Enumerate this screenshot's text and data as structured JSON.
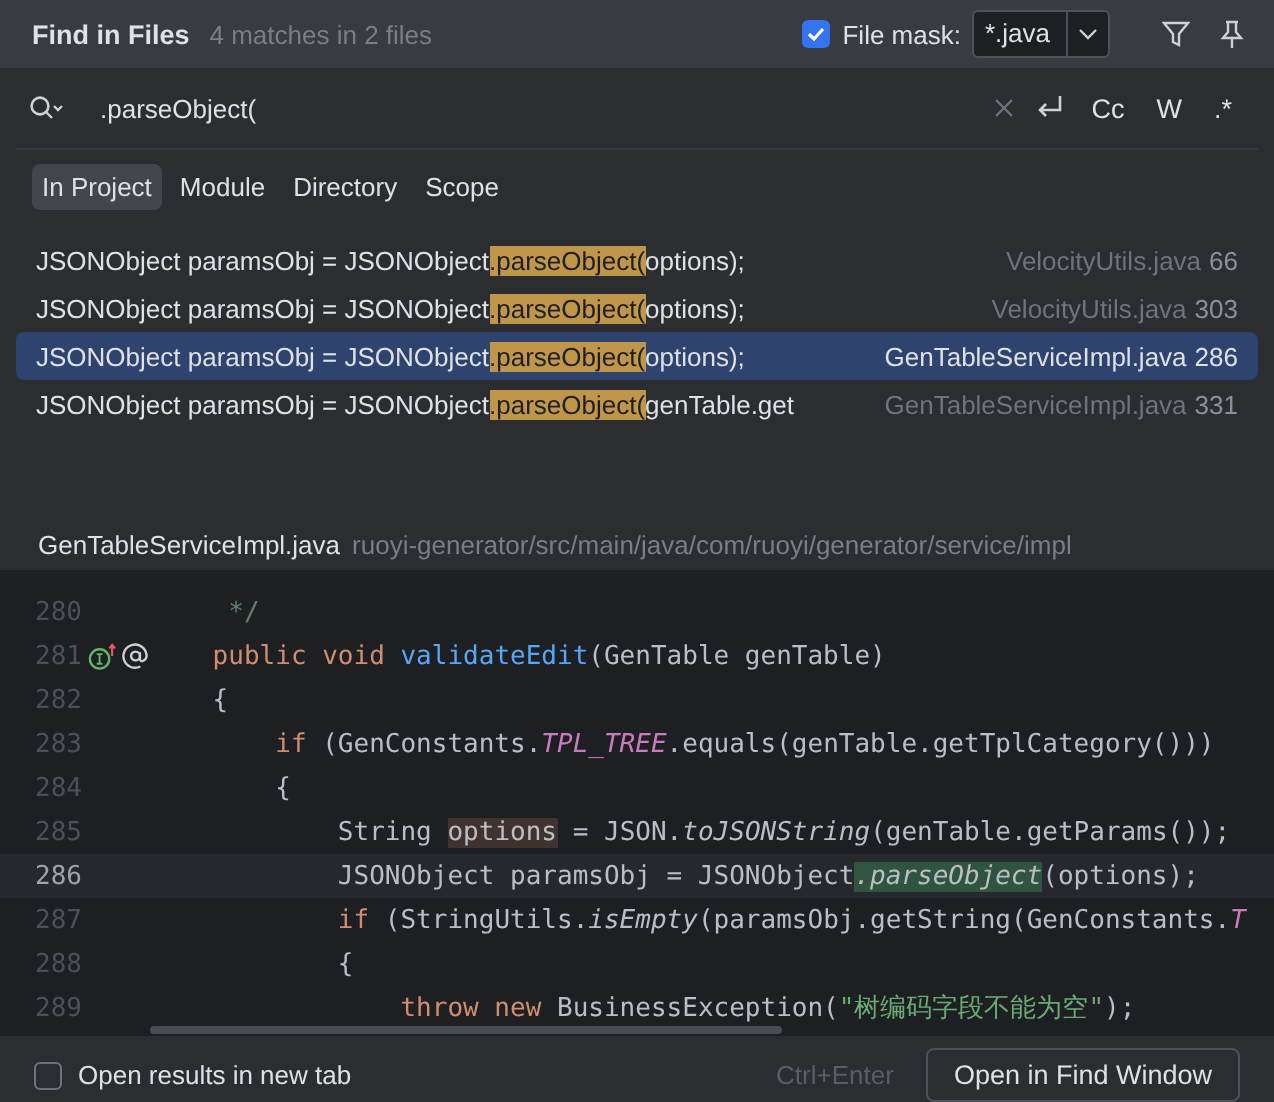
{
  "dialog": {
    "title": "Find in Files",
    "match_summary": "4 matches in 2 files",
    "file_mask": {
      "label": "File mask:",
      "checked": true,
      "value": "*.java"
    }
  },
  "search": {
    "value": ".parseObject(",
    "options": [
      "Cc",
      "W",
      ".*"
    ]
  },
  "scopes": [
    {
      "label": "In Project",
      "selected": true
    },
    {
      "label": "Module",
      "selected": false
    },
    {
      "label": "Directory",
      "selected": false
    },
    {
      "label": "Scope",
      "selected": false
    }
  ],
  "results": [
    {
      "prefix": "JSONObject paramsObj = JSONObject",
      "match": ".parseObject(",
      "suffix": "options);",
      "file": "VelocityUtils.java",
      "line": "66",
      "selected": false
    },
    {
      "prefix": "JSONObject paramsObj = JSONObject",
      "match": ".parseObject(",
      "suffix": "options);",
      "file": "VelocityUtils.java",
      "line": "303",
      "selected": false
    },
    {
      "prefix": "JSONObject paramsObj = JSONObject",
      "match": ".parseObject(",
      "suffix": "options);",
      "file": "GenTableServiceImpl.java",
      "line": "286",
      "selected": true
    },
    {
      "prefix": "JSONObject paramsObj = JSONObject",
      "match": ".parseObject(",
      "suffix": "genTable.get",
      "file": "GenTableServiceImpl.java",
      "line": "331",
      "selected": false
    }
  ],
  "preview": {
    "file": "GenTableServiceImpl.java",
    "path": "ruoyi-generator/src/main/java/com/ruoyi/generator/service/impl",
    "lines": [
      {
        "number": "280",
        "current": false,
        "gutter_icons": false,
        "tokens": [
          {
            "kind": "comment",
            "text": "     */"
          }
        ]
      },
      {
        "number": "281",
        "current": false,
        "gutter_icons": true,
        "tokens": [
          {
            "kind": "keyword",
            "text": "    public void "
          },
          {
            "kind": "method",
            "text": "validateEdit"
          },
          {
            "kind": "plain",
            "text": "(GenTable genTable)"
          }
        ]
      },
      {
        "number": "282",
        "current": false,
        "gutter_icons": false,
        "tokens": [
          {
            "kind": "plain",
            "text": "    {"
          }
        ]
      },
      {
        "number": "283",
        "current": false,
        "gutter_icons": false,
        "tokens": [
          {
            "kind": "keyword",
            "text": "        if "
          },
          {
            "kind": "plain",
            "text": "(GenConstants."
          },
          {
            "kind": "constant",
            "text": "TPL_TREE"
          },
          {
            "kind": "plain",
            "text": ".equals(genTable.getTplCategory()))"
          }
        ]
      },
      {
        "number": "284",
        "current": false,
        "gutter_icons": false,
        "tokens": [
          {
            "kind": "plain",
            "text": "        {"
          }
        ]
      },
      {
        "number": "285",
        "current": false,
        "gutter_icons": false,
        "tokens": [
          {
            "kind": "plain",
            "text": "            String "
          },
          {
            "kind": "usage",
            "text": "options"
          },
          {
            "kind": "plain",
            "text": " = JSON."
          },
          {
            "kind": "static",
            "text": "toJSONString"
          },
          {
            "kind": "plain",
            "text": "(genTable.getParams());"
          }
        ]
      },
      {
        "number": "286",
        "current": true,
        "gutter_icons": false,
        "tokens": [
          {
            "kind": "plain",
            "text": "            JSONObject paramsObj = JSONObject"
          },
          {
            "kind": "match",
            "text": ".parseObject"
          },
          {
            "kind": "plain",
            "text": "(options);"
          }
        ]
      },
      {
        "number": "287",
        "current": false,
        "gutter_icons": false,
        "tokens": [
          {
            "kind": "keyword",
            "text": "            if "
          },
          {
            "kind": "plain",
            "text": "(StringUtils."
          },
          {
            "kind": "static",
            "text": "isEmpty"
          },
          {
            "kind": "plain",
            "text": "(paramsObj.getString(GenConstants."
          },
          {
            "kind": "constant",
            "text": "T"
          }
        ]
      },
      {
        "number": "288",
        "current": false,
        "gutter_icons": false,
        "tokens": [
          {
            "kind": "plain",
            "text": "            {"
          }
        ]
      },
      {
        "number": "289",
        "current": false,
        "gutter_icons": false,
        "tokens": [
          {
            "kind": "keyword",
            "text": "                throw new "
          },
          {
            "kind": "plain",
            "text": "BusinessException("
          },
          {
            "kind": "string",
            "text": "\"树编码字段不能为空\""
          },
          {
            "kind": "plain",
            "text": ");"
          }
        ]
      }
    ]
  },
  "footer": {
    "new_tab": {
      "label": "Open results in new tab",
      "checked": false
    },
    "shortcut": "Ctrl+Enter",
    "button": "Open in Find Window"
  }
}
